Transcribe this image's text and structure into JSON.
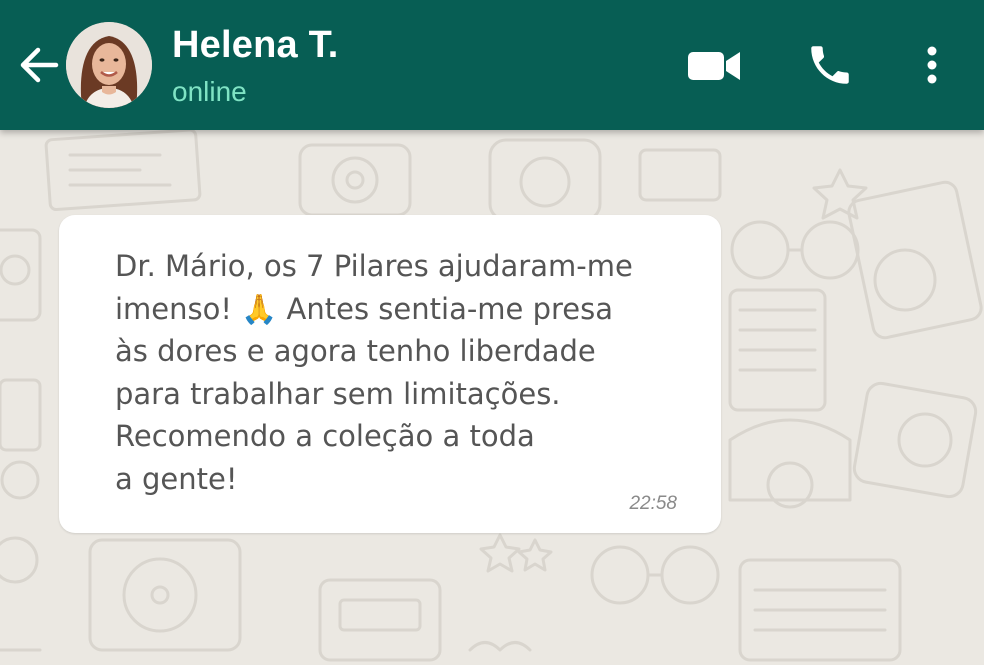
{
  "header": {
    "contact_name": "Helena T.",
    "status": "online",
    "background_color": "#075e54",
    "status_color": "#7fe3c4",
    "icons": {
      "back": "arrow-left-icon",
      "avatar": "contact-avatar",
      "video": "video-camera-icon",
      "call": "phone-icon",
      "menu": "more-vertical-icon"
    }
  },
  "chat": {
    "wallpaper_color": "#ebe8e2",
    "messages": [
      {
        "direction": "incoming",
        "text": "Dr. Mário, os 7 Pilares ajudaram-me\nimenso! 🙏 Antes sentia-me presa\nàs dores e agora tenho liberdade\npara trabalhar sem limitações.\nRecomendo a coleção a toda\na gente!",
        "time": "22:58",
        "bubble_color": "#ffffff"
      }
    ]
  }
}
